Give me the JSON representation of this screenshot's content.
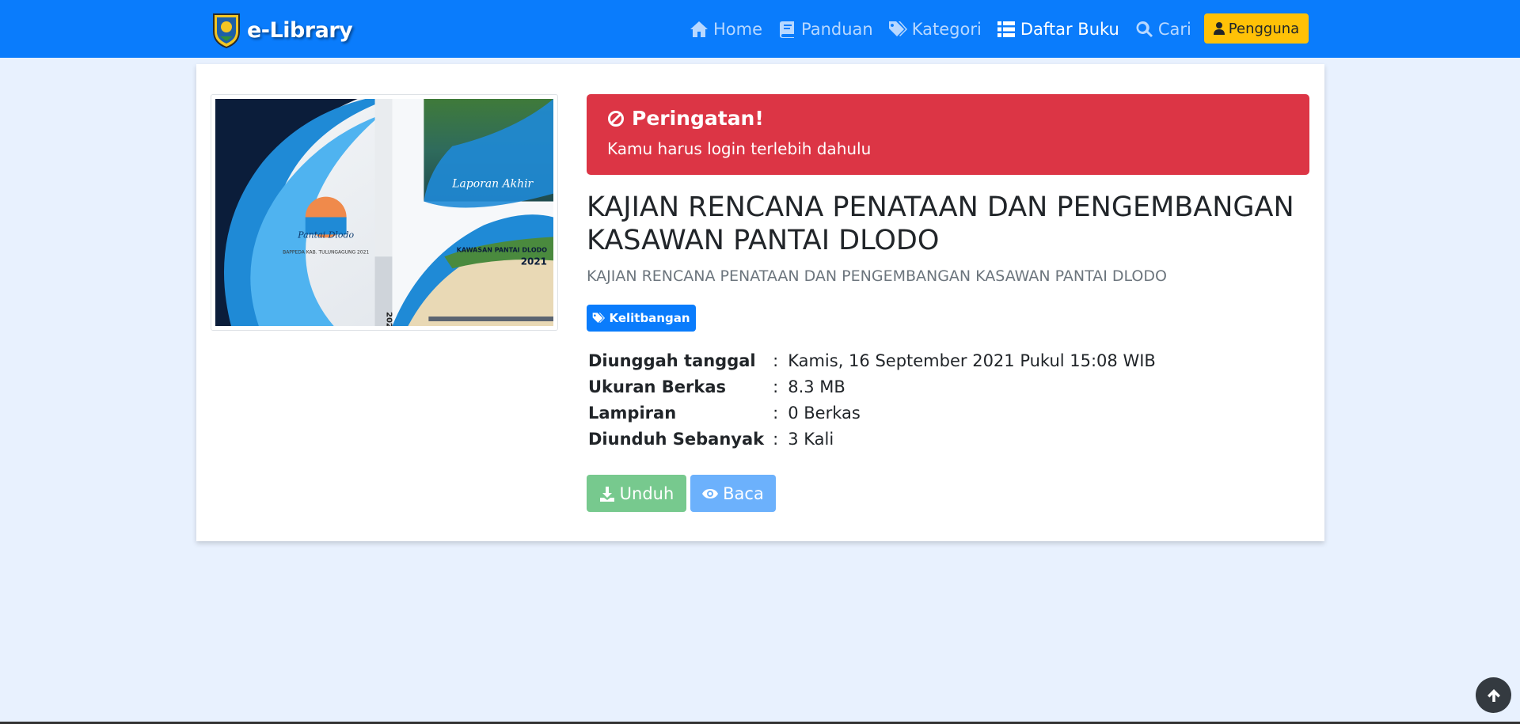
{
  "brand": {
    "name": "e-Library",
    "logo_icon": "tulungagung-emblem-icon"
  },
  "nav": {
    "items": [
      {
        "label": "Home",
        "icon": "home-icon"
      },
      {
        "label": "Panduan",
        "icon": "book-icon"
      },
      {
        "label": "Kategori",
        "icon": "tags-icon"
      },
      {
        "label": "Daftar Buku",
        "icon": "list-icon",
        "active": true
      },
      {
        "label": "Cari",
        "icon": "search-icon"
      }
    ],
    "user_button": {
      "label": "Pengguna",
      "icon": "user-icon"
    }
  },
  "alert": {
    "title": "Peringatan!",
    "message": "Kamu harus login terlebih dahulu",
    "icon": "ban-icon"
  },
  "book": {
    "title": "KAJIAN RENCANA PENATAAN DAN PENGEMBANGAN KASAWAN PANTAI DLODO",
    "subtitle": "KAJIAN RENCANA PENATAAN DAN PENGEMBANGAN KASAWAN PANTAI DLODO",
    "category": "Kelitbangan",
    "details": [
      {
        "key": "Diunggah tanggal",
        "sep": ":",
        "value": "Kamis, 16 September 2021 Pukul 15:08 WIB"
      },
      {
        "key": "Ukuran Berkas",
        "sep": ":",
        "value": "8.3 MB"
      },
      {
        "key": "Lampiran",
        "sep": ":",
        "value": "0 Berkas"
      },
      {
        "key": "Diunduh Sebanyak",
        "sep": ":",
        "value": "3 Kali"
      }
    ]
  },
  "cover_text": {
    "spine_year": "2021",
    "front_label": "Laporan Akhir",
    "front_title": "KAWASAN PANTAI DLODO",
    "front_year": "2021",
    "back_logo": "Pantai Dlodo",
    "back_org": "BAPPEDA KAB. TULUNGAGUNG 2021"
  },
  "actions": {
    "download": "Unduh",
    "read": "Baca"
  },
  "colors": {
    "navbar": "#0a7cfc",
    "danger": "#dc3545",
    "warning": "#ffc107",
    "success_muted": "#77c98e",
    "primary_muted": "#6cb1fc",
    "page_bg": "#e8f1fe"
  }
}
